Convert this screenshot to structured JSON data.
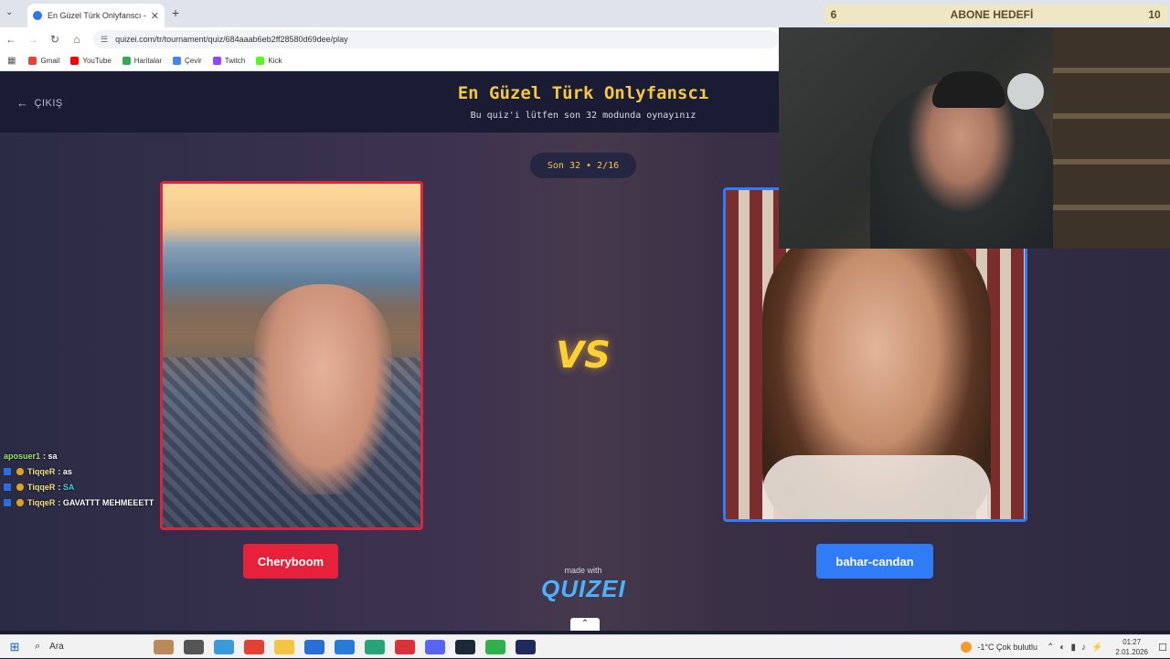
{
  "browser": {
    "tab_title": "En Güzel Türk Onlyfanscı - Tier",
    "url": "quizei.com/tr/tournament/quiz/684aaab6eb2ff28580d69dee/play",
    "bookmarks": [
      "Gmail",
      "YouTube",
      "Haritalar",
      "Çevir",
      "Twitch",
      "Kick"
    ]
  },
  "quiz": {
    "exit_label": "ÇIKIŞ",
    "title": "En Güzel Türk Onlyfanscı",
    "subtitle": "Bu quiz'i lütfen son 32 modunda oynayınız",
    "round": "Son 32 • 2/16",
    "vs": "VS",
    "left_choice": "Cheryboom",
    "right_choice": "bahar-candan",
    "made_with": "made with",
    "brand": "QUIZEI"
  },
  "chat": [
    {
      "user": "aposuer1",
      "msg": "sa"
    },
    {
      "user": "TiqqeR",
      "msg": "as"
    },
    {
      "user": "TiqqeR",
      "msg": "SA"
    },
    {
      "user": "TiqqeR",
      "msg": "GAVATTT MEHMEEETT"
    }
  ],
  "overlay": {
    "goal_label": "ABONE HEDEFİ",
    "goal_current": "6",
    "goal_target": "10"
  },
  "taskbar": {
    "search": "Ara",
    "weather": "-1°C Çok bulutlu",
    "time": "01:27",
    "date": "2.01.2026"
  },
  "colors": {
    "left_accent": "#e8213a",
    "right_accent": "#2f7cf6",
    "title_yellow": "#f5c842"
  }
}
